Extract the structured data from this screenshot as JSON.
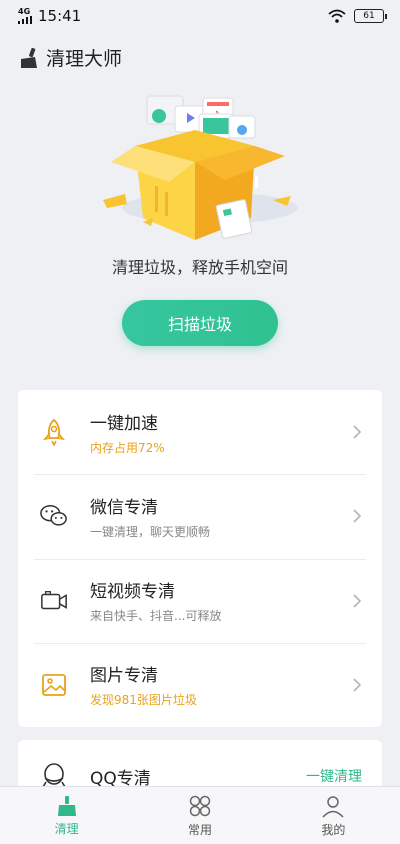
{
  "status": {
    "time": "15:41",
    "network_top": "4G",
    "battery": "61"
  },
  "header": {
    "title": "清理大师",
    "icon": "broom-icon"
  },
  "hero": {
    "tagline": "清理垃圾，释放手机空间",
    "scan_label": "扫描垃圾"
  },
  "features": [
    {
      "title": "一键加速",
      "subtitle": "内存占用72%",
      "icon": "rocket-icon",
      "accent": true
    },
    {
      "title": "微信专清",
      "subtitle": "一键清理，聊天更顺畅",
      "icon": "wechat-icon",
      "accent": false
    },
    {
      "title": "短视频专清",
      "subtitle": "来自快手、抖音...可释放",
      "icon": "video-camera-icon",
      "accent": false
    },
    {
      "title": "图片专清",
      "subtitle": "发现981张图片垃圾",
      "icon": "image-icon",
      "accent": true
    }
  ],
  "qq": {
    "title": "QQ专清",
    "action": "一键清理"
  },
  "tabs": [
    {
      "label": "清理",
      "icon": "broom-icon",
      "active": true
    },
    {
      "label": "常用",
      "icon": "grid-icon",
      "active": false
    },
    {
      "label": "我的",
      "icon": "user-icon",
      "active": false
    }
  ],
  "colors": {
    "brand_green": "#2fc28f",
    "accent_orange": "#e9a21b",
    "background": "#eef0f4"
  }
}
